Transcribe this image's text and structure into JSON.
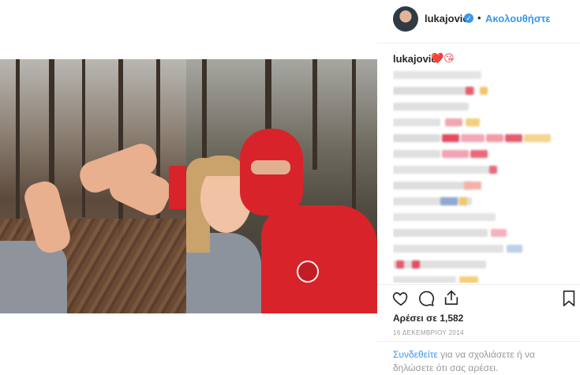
{
  "post": {
    "username": "lukajovic",
    "follow_label": "Ακολουθήστε",
    "separator": "•",
    "verified_icon": "verified-check-icon",
    "caption_user": "lukajovic",
    "caption_emoji": "❤️😘",
    "likes_text": "Αρέσει σε 1,582",
    "date_text": "16 ΔΕΚΕΜΒΡΙΟΥ 2014",
    "login_link": "Συνδεθείτε",
    "login_rest": " για να σχολιάσετε ή να δηλώσετε ότι σας αρέσει.",
    "icons": {
      "like": "heart-icon",
      "comment": "comment-icon",
      "share": "share-icon",
      "save": "bookmark-icon"
    }
  },
  "colors": {
    "link": "#3897f0",
    "text": "#262626",
    "muted": "#999999",
    "heart": "#ed4956"
  }
}
